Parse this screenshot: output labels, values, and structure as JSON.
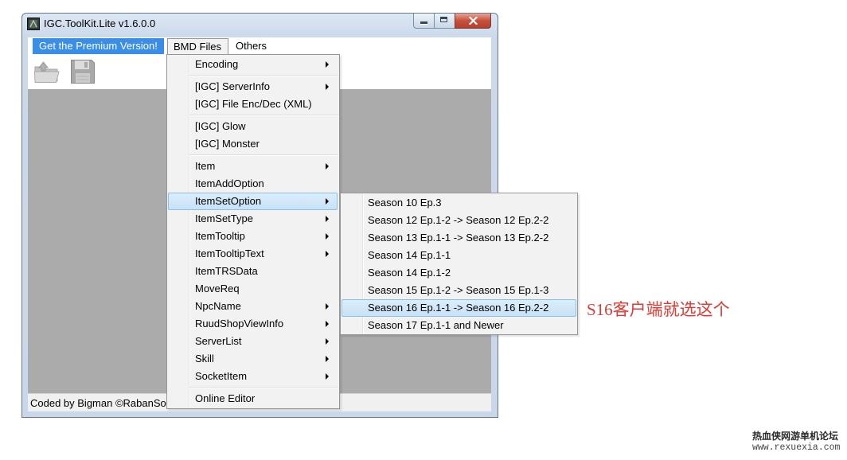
{
  "window": {
    "title": "IGC.ToolKit.Lite v1.6.0.0",
    "app_icon": "app-icon",
    "controls": [
      "minimize-icon",
      "maximize-icon",
      "close-icon"
    ]
  },
  "menubar": {
    "premium": {
      "label": "Get the Premium Version!",
      "highlighted": true
    },
    "bmd_files": {
      "label": "BMD Files",
      "open": true
    },
    "others": {
      "label": "Others"
    }
  },
  "toolbar": {
    "open_icon": "open-folder-icon",
    "save_icon": "save-floppy-icon",
    "disabled": true
  },
  "statusbar": {
    "text": "Coded by Bigman ©RabanSo"
  },
  "bmd_menu": {
    "items": [
      {
        "label": "Encoding",
        "submenu": true
      },
      {
        "label": "[IGC] ServerInfo",
        "submenu": true
      },
      {
        "label": "[IGC] File Enc/Dec (XML)",
        "submenu": false
      },
      {
        "label": "[IGC] Glow",
        "submenu": false
      },
      {
        "label": "[IGC] Monster",
        "submenu": false
      },
      {
        "label": "Item",
        "submenu": true
      },
      {
        "label": "ItemAddOption",
        "submenu": false
      },
      {
        "label": "ItemSetOption",
        "submenu": true,
        "highlighted": true
      },
      {
        "label": "ItemSetType",
        "submenu": true
      },
      {
        "label": "ItemTooltip",
        "submenu": true
      },
      {
        "label": "ItemTooltipText",
        "submenu": true
      },
      {
        "label": "ItemTRSData",
        "submenu": false
      },
      {
        "label": "MoveReq",
        "submenu": false
      },
      {
        "label": "NpcName",
        "submenu": true
      },
      {
        "label": "RuudShopViewInfo",
        "submenu": true
      },
      {
        "label": "ServerList",
        "submenu": true
      },
      {
        "label": "Skill",
        "submenu": true
      },
      {
        "label": "SocketItem",
        "submenu": true
      },
      {
        "label": "Online Editor",
        "submenu": false
      }
    ]
  },
  "itemsetoption_menu": {
    "items": [
      {
        "label": "Season 10 Ep.3"
      },
      {
        "label": "Season 12 Ep.1-2 -> Season 12 Ep.2-2"
      },
      {
        "label": "Season 13 Ep.1-1 -> Season 13 Ep.2-2"
      },
      {
        "label": "Season 14 Ep.1-1"
      },
      {
        "label": "Season 14 Ep.1-2"
      },
      {
        "label": "Season 15 Ep.1-2 -> Season 15 Ep.1-3"
      },
      {
        "label": "Season 16 Ep.1-1 -> Season 16 Ep.2-2",
        "highlighted": true
      },
      {
        "label": "Season 17 Ep.1-1 and Newer"
      }
    ]
  },
  "annotation": {
    "text": "S16客户端就选这个"
  },
  "watermark": {
    "line1": "热血侠网游单机论坛",
    "line2": "www.rexuexia.com"
  },
  "colors": {
    "premium_bg": "#3a8ee8",
    "menu_highlight_bg": "#c7e2f7",
    "menu_highlight_border": "#8cbfe9",
    "panel_gray": "#ababab",
    "annotation_red": "#e23a32",
    "close_red": "#c8503c"
  }
}
